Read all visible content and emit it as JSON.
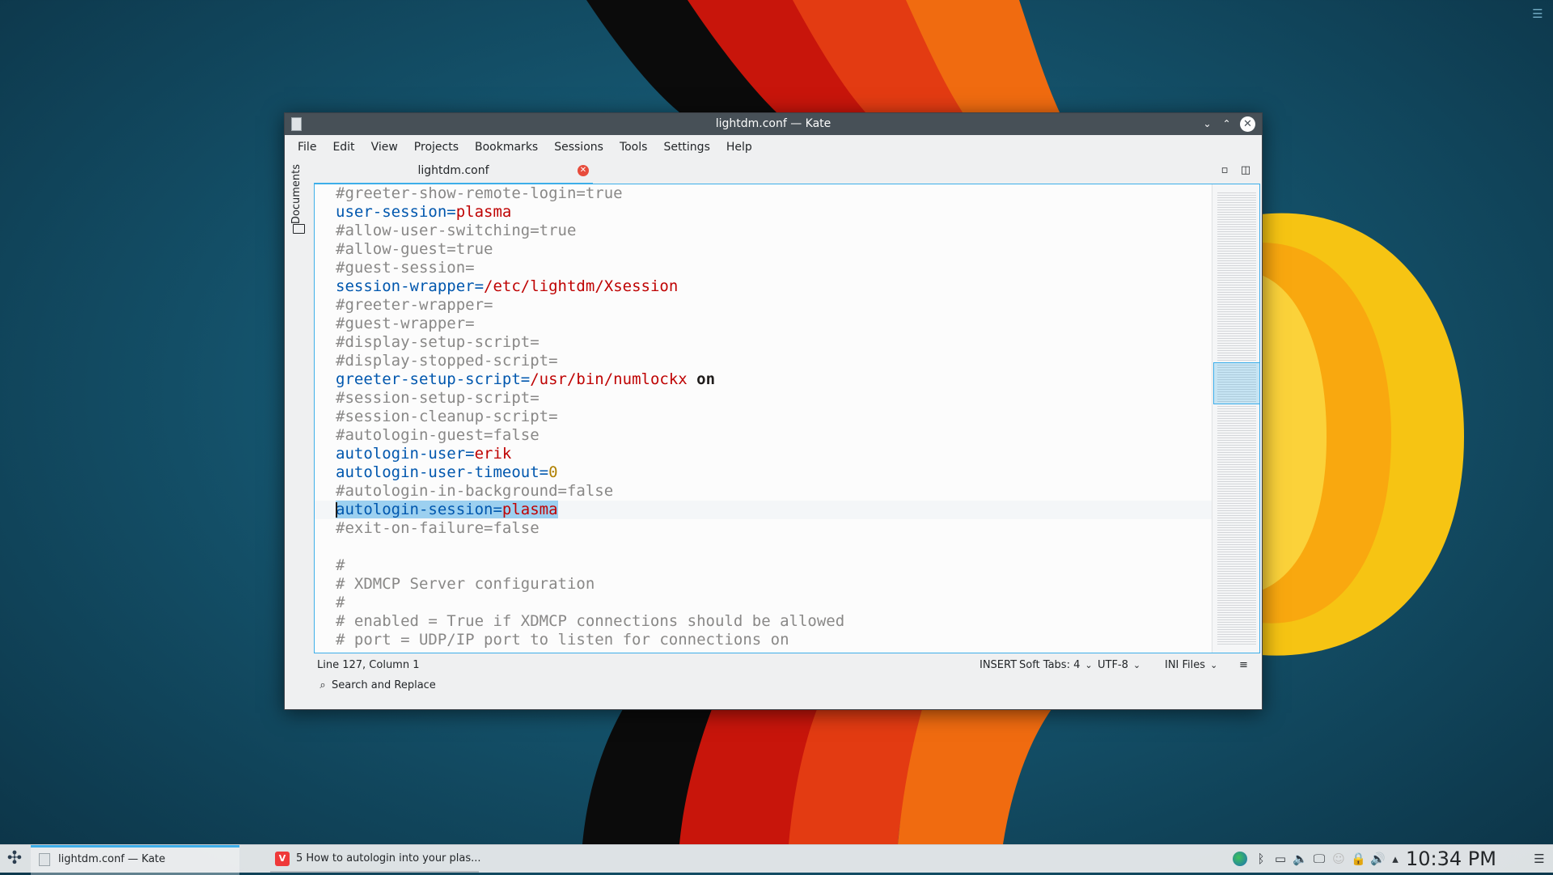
{
  "window": {
    "title": "lightdm.conf — Kate"
  },
  "menu": [
    "File",
    "Edit",
    "View",
    "Projects",
    "Bookmarks",
    "Sessions",
    "Tools",
    "Settings",
    "Help"
  ],
  "sidebar": {
    "documents_label": "Documents"
  },
  "tab": {
    "label": "lightdm.conf"
  },
  "editor": {
    "lines": [
      {
        "t": "comment",
        "text": "#greeter-show-remote-login=true"
      },
      {
        "t": "kv",
        "key": "user-session",
        "val": "plasma"
      },
      {
        "t": "comment",
        "text": "#allow-user-switching=true"
      },
      {
        "t": "comment",
        "text": "#allow-guest=true"
      },
      {
        "t": "comment",
        "text": "#guest-session="
      },
      {
        "t": "kv",
        "key": "session-wrapper",
        "val": "/etc/lightdm/Xsession"
      },
      {
        "t": "comment",
        "text": "#greeter-wrapper="
      },
      {
        "t": "comment",
        "text": "#guest-wrapper="
      },
      {
        "t": "comment",
        "text": "#display-setup-script="
      },
      {
        "t": "comment",
        "text": "#display-stopped-script="
      },
      {
        "t": "kv",
        "key": "greeter-setup-script",
        "val": "/usr/bin/numlockx",
        "extra": " on"
      },
      {
        "t": "comment",
        "text": "#session-setup-script="
      },
      {
        "t": "comment",
        "text": "#session-cleanup-script="
      },
      {
        "t": "comment",
        "text": "#autologin-guest=false"
      },
      {
        "t": "kv",
        "key": "autologin-user",
        "val": "erik"
      },
      {
        "t": "kvnum",
        "key": "autologin-user-timeout",
        "val": "0"
      },
      {
        "t": "comment",
        "text": "#autologin-in-background=false"
      },
      {
        "t": "kv",
        "key": "autologin-session",
        "val": "plasma",
        "selected": true,
        "current": true
      },
      {
        "t": "comment",
        "text": "#exit-on-failure=false"
      },
      {
        "t": "blank",
        "text": ""
      },
      {
        "t": "comment",
        "text": "#"
      },
      {
        "t": "comment",
        "text": "# XDMCP Server configuration"
      },
      {
        "t": "comment",
        "text": "#"
      },
      {
        "t": "comment",
        "text": "# enabled = True if XDMCP connections should be allowed"
      },
      {
        "t": "comment",
        "text": "# port = UDP/IP port to listen for connections on"
      }
    ]
  },
  "status": {
    "position": "Line 127, Column 1",
    "mode": "INSERT",
    "indent": "Soft Tabs: 4",
    "encoding": "UTF-8",
    "syntax": "INI Files"
  },
  "search": {
    "label": "Search and Replace"
  },
  "taskbar": {
    "tasks": [
      "lightdm.conf  — Kate",
      "5 How to autologin into your plas..."
    ],
    "clock": "10:34 PM"
  },
  "colors": {
    "accent": "#3daee9",
    "titlebar": "#475057",
    "key": "#0057ae",
    "value": "#bf0303",
    "comment": "#898887"
  }
}
